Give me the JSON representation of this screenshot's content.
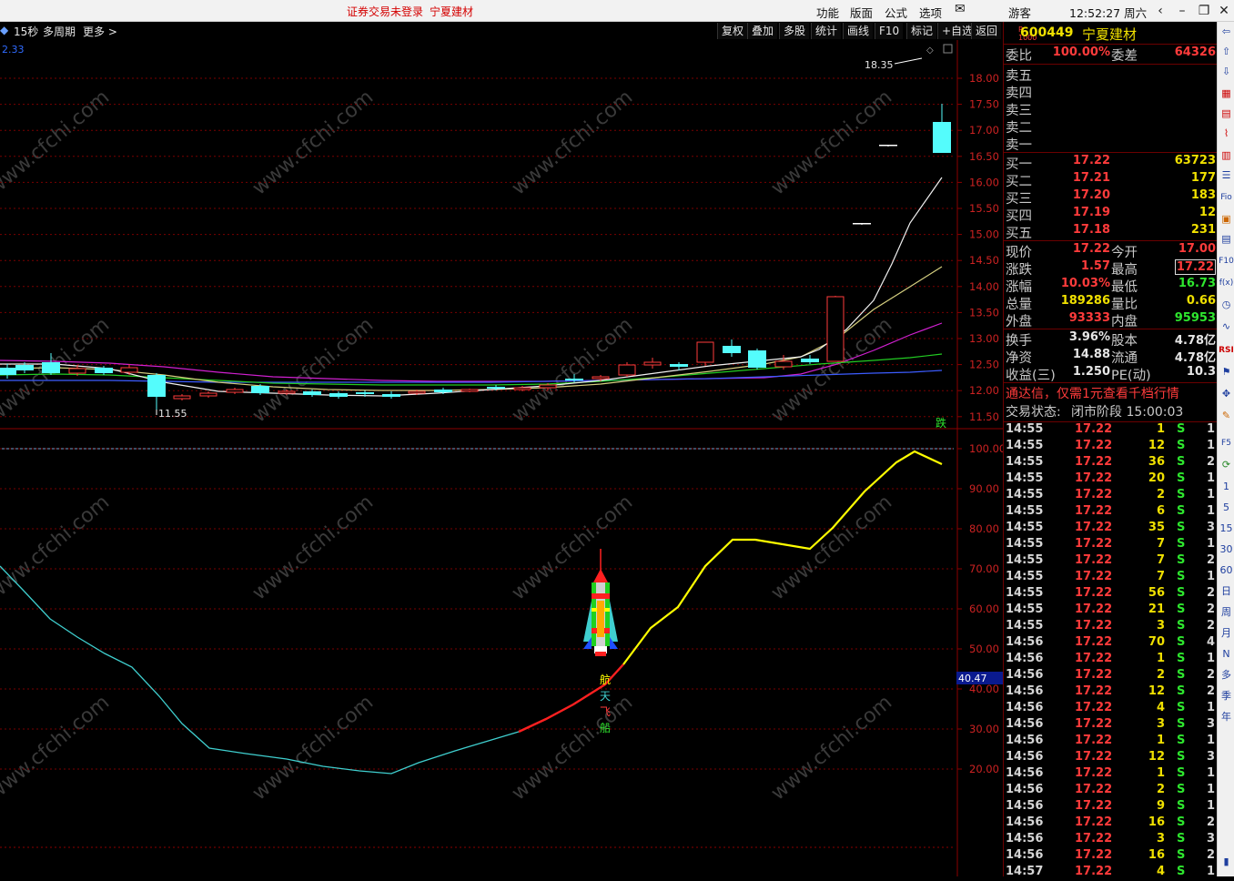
{
  "titlebar": {
    "warning": "证券交易未登录",
    "stock_name": "宁夏建材",
    "menus": [
      "功能",
      "版面",
      "公式",
      "选项"
    ],
    "guest": "游客",
    "time": "12:52:27",
    "weekday": "周六"
  },
  "toolbar": {
    "left": [
      "15秒",
      "多周期",
      "更多 >"
    ],
    "buttons": [
      "复权",
      "叠加",
      "多股",
      "统计",
      "画线",
      "F10",
      "标记",
      "+自选",
      "返回"
    ]
  },
  "price_chart": {
    "price_axis": [
      "18.00",
      "17.50",
      "17.00",
      "16.50",
      "16.00",
      "15.50",
      "15.00",
      "14.50",
      "14.00",
      "13.50",
      "13.00",
      "12.50",
      "12.00",
      "11.50"
    ],
    "high_label": "18.35",
    "low_label": "11.55",
    "corner_value": "2.33",
    "fall_marker": "跌"
  },
  "indicator_chart": {
    "axis": [
      "100.00",
      "90.00",
      "80.00",
      "70.00",
      "60.00",
      "50.00",
      "40.00",
      "30.00",
      "20.00"
    ],
    "current_value": "40.47",
    "signal_text": [
      "航",
      "天",
      "飞",
      "船"
    ]
  },
  "watermark": "www.cfchi.com",
  "quote": {
    "code": "600449",
    "name": "宁夏建材",
    "weibi_label": "委比",
    "weibi": "100.00%",
    "weicha_label": "委差",
    "weicha": "64326",
    "sells": [
      {
        "label": "卖五",
        "price": "",
        "vol": ""
      },
      {
        "label": "卖四",
        "price": "",
        "vol": ""
      },
      {
        "label": "卖三",
        "price": "",
        "vol": ""
      },
      {
        "label": "卖二",
        "price": "",
        "vol": ""
      },
      {
        "label": "卖一",
        "price": "",
        "vol": ""
      }
    ],
    "buys": [
      {
        "label": "买一",
        "price": "17.22",
        "vol": "63723"
      },
      {
        "label": "买二",
        "price": "17.21",
        "vol": "177"
      },
      {
        "label": "买三",
        "price": "17.20",
        "vol": "183"
      },
      {
        "label": "买四",
        "price": "17.19",
        "vol": "12"
      },
      {
        "label": "买五",
        "price": "17.18",
        "vol": "231"
      }
    ],
    "stats": [
      {
        "l1": "现价",
        "v1": "17.22",
        "l2": "今开",
        "v2": "17.00"
      },
      {
        "l1": "涨跌",
        "v1": "1.57",
        "l2": "最高",
        "v2": "17.22"
      },
      {
        "l1": "涨幅",
        "v1": "10.03%",
        "l2": "最低",
        "v2": "16.73"
      },
      {
        "l1": "总量",
        "v1": "189286",
        "l2": "量比",
        "v2": "0.66"
      },
      {
        "l1": "外盘",
        "v1": "93333",
        "l2": "内盘",
        "v2": "95953"
      }
    ],
    "fin": [
      {
        "l1": "换手",
        "v1": "3.96%",
        "l2": "股本",
        "v2": "4.78亿"
      },
      {
        "l1": "净资",
        "v1": "14.88",
        "l2": "流通",
        "v2": "4.78亿"
      },
      {
        "l1": "收益(三)",
        "v1": "1.250",
        "l2": "PE(动)",
        "v2": "10.3"
      }
    ],
    "promo": "通达信，仅需1元查看千档行情",
    "status_label": "交易状态:",
    "status_value": "闭市阶段 15:00:03"
  },
  "ticks": [
    {
      "t": "14:55",
      "p": "17.22",
      "v": "1",
      "bs": "S",
      "n": "1"
    },
    {
      "t": "14:55",
      "p": "17.22",
      "v": "12",
      "bs": "S",
      "n": "1"
    },
    {
      "t": "14:55",
      "p": "17.22",
      "v": "36",
      "bs": "S",
      "n": "2"
    },
    {
      "t": "14:55",
      "p": "17.22",
      "v": "20",
      "bs": "S",
      "n": "1"
    },
    {
      "t": "14:55",
      "p": "17.22",
      "v": "2",
      "bs": "S",
      "n": "1"
    },
    {
      "t": "14:55",
      "p": "17.22",
      "v": "6",
      "bs": "S",
      "n": "1"
    },
    {
      "t": "14:55",
      "p": "17.22",
      "v": "35",
      "bs": "S",
      "n": "3"
    },
    {
      "t": "14:55",
      "p": "17.22",
      "v": "7",
      "bs": "S",
      "n": "1"
    },
    {
      "t": "14:55",
      "p": "17.22",
      "v": "7",
      "bs": "S",
      "n": "2"
    },
    {
      "t": "14:55",
      "p": "17.22",
      "v": "7",
      "bs": "S",
      "n": "1"
    },
    {
      "t": "14:55",
      "p": "17.22",
      "v": "56",
      "bs": "S",
      "n": "2"
    },
    {
      "t": "14:55",
      "p": "17.22",
      "v": "21",
      "bs": "S",
      "n": "2"
    },
    {
      "t": "14:55",
      "p": "17.22",
      "v": "3",
      "bs": "S",
      "n": "2"
    },
    {
      "t": "14:56",
      "p": "17.22",
      "v": "70",
      "bs": "S",
      "n": "4"
    },
    {
      "t": "14:56",
      "p": "17.22",
      "v": "1",
      "bs": "S",
      "n": "1"
    },
    {
      "t": "14:56",
      "p": "17.22",
      "v": "2",
      "bs": "S",
      "n": "2"
    },
    {
      "t": "14:56",
      "p": "17.22",
      "v": "12",
      "bs": "S",
      "n": "2"
    },
    {
      "t": "14:56",
      "p": "17.22",
      "v": "4",
      "bs": "S",
      "n": "1"
    },
    {
      "t": "14:56",
      "p": "17.22",
      "v": "3",
      "bs": "S",
      "n": "3"
    },
    {
      "t": "14:56",
      "p": "17.22",
      "v": "1",
      "bs": "S",
      "n": "1"
    },
    {
      "t": "14:56",
      "p": "17.22",
      "v": "12",
      "bs": "S",
      "n": "3"
    },
    {
      "t": "14:56",
      "p": "17.22",
      "v": "1",
      "bs": "S",
      "n": "1"
    },
    {
      "t": "14:56",
      "p": "17.22",
      "v": "2",
      "bs": "S",
      "n": "1"
    },
    {
      "t": "14:56",
      "p": "17.22",
      "v": "9",
      "bs": "S",
      "n": "1"
    },
    {
      "t": "14:56",
      "p": "17.22",
      "v": "16",
      "bs": "S",
      "n": "2"
    },
    {
      "t": "14:56",
      "p": "17.22",
      "v": "3",
      "bs": "S",
      "n": "3"
    },
    {
      "t": "14:56",
      "p": "17.22",
      "v": "16",
      "bs": "S",
      "n": "2"
    },
    {
      "t": "14:57",
      "p": "17.22",
      "v": "4",
      "bs": "S",
      "n": "1"
    }
  ],
  "sidebar": [
    "1",
    "5",
    "15",
    "30",
    "60",
    "日",
    "周",
    "月",
    "N",
    "多",
    "季",
    "年"
  ]
}
